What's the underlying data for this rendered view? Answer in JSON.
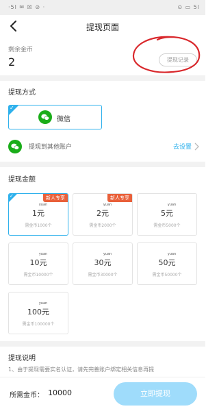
{
  "status_bar": {
    "left": "·5l ✉ ☒ ⊘ ·",
    "right": "⊙ ▭ 5l"
  },
  "nav": {
    "title": "提现页面"
  },
  "balance": {
    "label": "剩余金币",
    "value": "2",
    "record_button": "提现记录"
  },
  "pay_method": {
    "section_title": "提现方式",
    "selected_label": "微信",
    "other_label": "提现到其他账户",
    "other_link": "去设置"
  },
  "amounts": {
    "section_title": "提现金额",
    "yuan_label": "yuan",
    "items": [
      {
        "amount": "1元",
        "desc": "需金币1000个",
        "badge": "新人专享",
        "selected": true
      },
      {
        "amount": "2元",
        "desc": "需金币2000个",
        "badge": "新人专享",
        "selected": false
      },
      {
        "amount": "5元",
        "desc": "需金币5000个",
        "badge": "",
        "selected": false
      },
      {
        "amount": "10元",
        "desc": "需金币10000个",
        "badge": "",
        "selected": false
      },
      {
        "amount": "30元",
        "desc": "需金币30000个",
        "badge": "",
        "selected": false
      },
      {
        "amount": "50元",
        "desc": "需金币50000个",
        "badge": "",
        "selected": false
      },
      {
        "amount": "100元",
        "desc": "需金币100000个",
        "badge": "",
        "selected": false
      }
    ]
  },
  "notes": {
    "title": "提现说明",
    "text": "1、由于提现需要实名认证，请先完善账户绑定相关信息再提"
  },
  "footer": {
    "label": "所需金币：",
    "value": "10000",
    "button": "立即提现"
  },
  "colors": {
    "accent": "#2fb1ec",
    "badge": "#e9603a",
    "wechat": "#1aad19",
    "button": "#9fdcfb",
    "annotation": "#d9282c"
  }
}
